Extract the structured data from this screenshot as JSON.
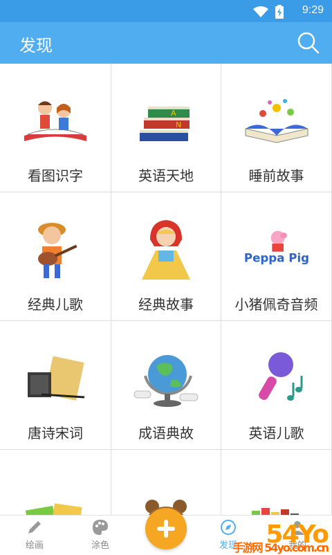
{
  "status": {
    "time": "9:29"
  },
  "app_bar": {
    "title": "发现",
    "search_icon": "search-icon"
  },
  "grid": {
    "items": [
      {
        "label": "看图识字",
        "icon": "kids-reading-book-icon"
      },
      {
        "label": "英语天地",
        "icon": "stacked-books-icon"
      },
      {
        "label": "睡前故事",
        "icon": "pop-up-storybook-icon"
      },
      {
        "label": "经典儿歌",
        "icon": "boy-playing-guitar-icon"
      },
      {
        "label": "经典故事",
        "icon": "little-red-riding-hood-icon"
      },
      {
        "label": "小猪佩奇音频",
        "icon": "peppa-pig-logo-icon"
      },
      {
        "label": "唐诗宋词",
        "icon": "scroll-and-ink-icon"
      },
      {
        "label": "成语典故",
        "icon": "globe-icon"
      },
      {
        "label": "英语儿歌",
        "icon": "microphone-music-icon"
      },
      {
        "label": "",
        "icon": "alphabet-cards-icon"
      },
      {
        "label": "",
        "icon": "bear-icon"
      },
      {
        "label": "",
        "icon": "bookshelf-icon"
      }
    ]
  },
  "peppa_logo_text": "Peppa Pig",
  "bottom_nav": {
    "items": [
      {
        "label": "绘画",
        "icon": "pencil-icon"
      },
      {
        "label": "涂色",
        "icon": "palette-icon"
      },
      {
        "label": "发现",
        "icon": "discover-icon"
      },
      {
        "label": "我的",
        "icon": "profile-icon"
      }
    ],
    "fab_icon": "plus-icon"
  },
  "watermark": {
    "main": "54Yo",
    "sub": "手游网 54yo.com.cn"
  },
  "colors": {
    "status_bar": "#3a9be6",
    "app_bar": "#50adf0",
    "fab": "#f5a623",
    "watermark": "#ff9a00"
  }
}
